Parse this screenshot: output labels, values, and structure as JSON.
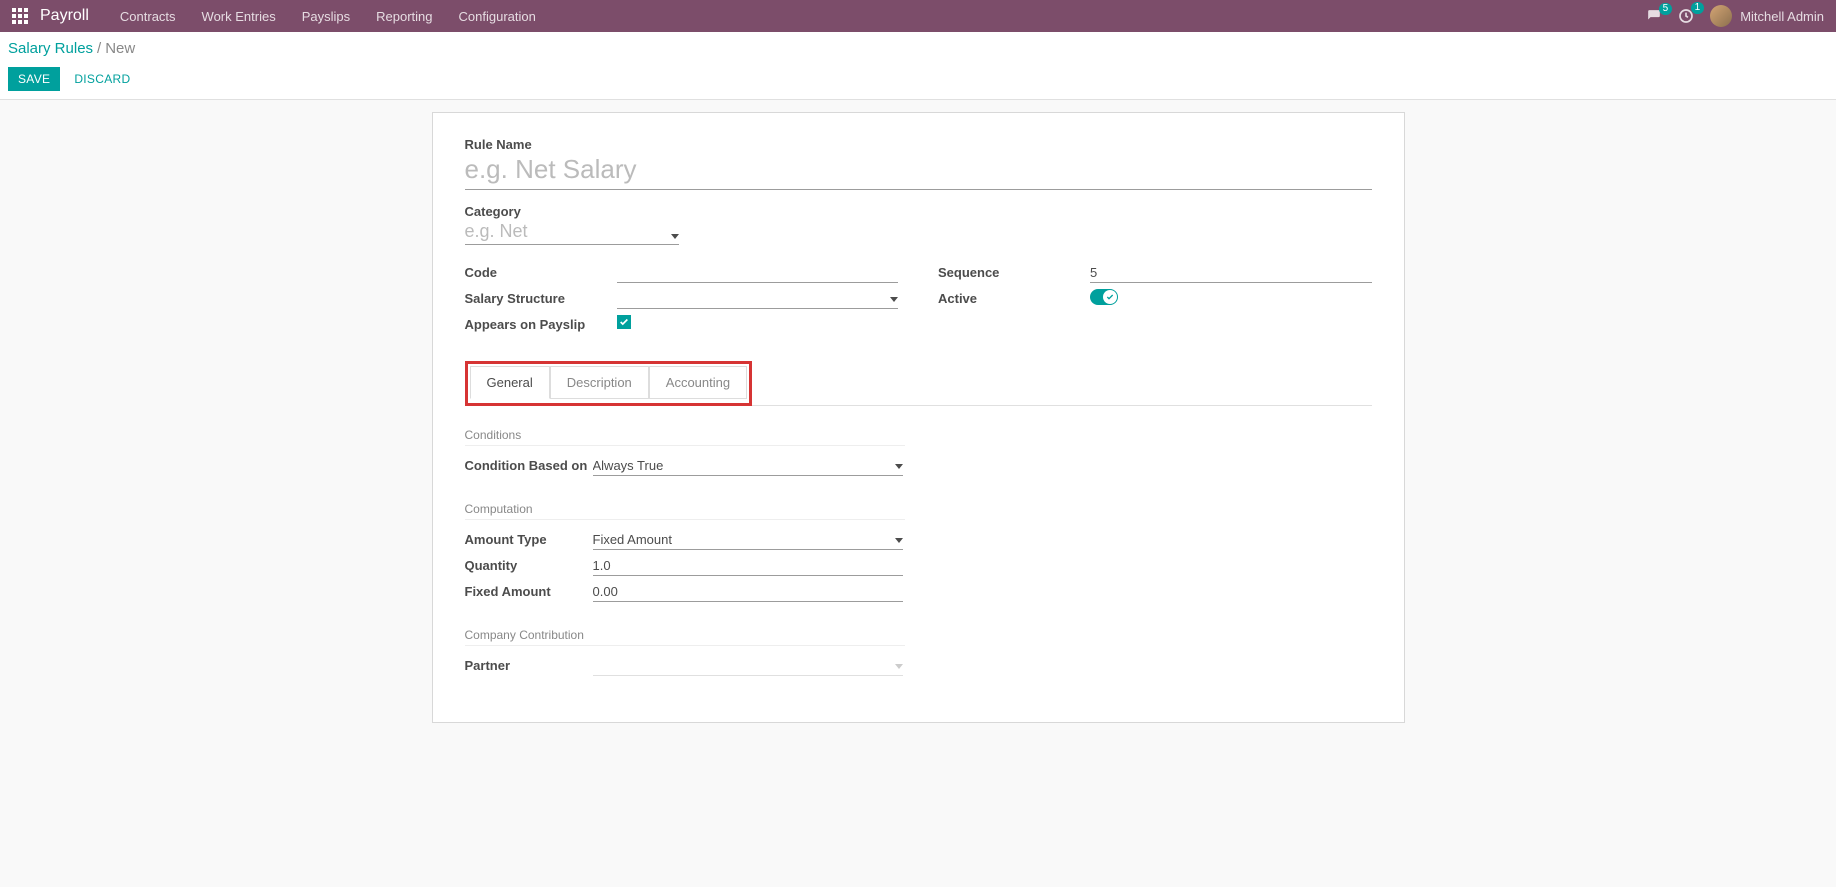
{
  "nav": {
    "brand": "Payroll",
    "items": [
      "Contracts",
      "Work Entries",
      "Payslips",
      "Reporting",
      "Configuration"
    ],
    "messages_badge": "5",
    "activities_badge": "1",
    "user_name": "Mitchell Admin"
  },
  "breadcrumb": {
    "parent": "Salary Rules",
    "current": "New"
  },
  "buttons": {
    "save": "SAVE",
    "discard": "DISCARD"
  },
  "form": {
    "rule_name_label": "Rule Name",
    "rule_name_placeholder": "e.g. Net Salary",
    "rule_name_value": "",
    "category_label": "Category",
    "category_placeholder": "e.g. Net",
    "category_value": "",
    "code_label": "Code",
    "code_value": "",
    "salary_structure_label": "Salary Structure",
    "salary_structure_value": "",
    "appears_label": "Appears on Payslip",
    "appears_value": true,
    "sequence_label": "Sequence",
    "sequence_value": "5",
    "active_label": "Active",
    "active_value": true
  },
  "tabs": [
    "General",
    "Description",
    "Accounting"
  ],
  "sections": {
    "conditions": {
      "title": "Conditions",
      "condition_based_label": "Condition Based on",
      "condition_based_value": "Always True"
    },
    "computation": {
      "title": "Computation",
      "amount_type_label": "Amount Type",
      "amount_type_value": "Fixed Amount",
      "quantity_label": "Quantity",
      "quantity_value": "1.0",
      "fixed_amount_label": "Fixed Amount",
      "fixed_amount_value": "0.00"
    },
    "company_contribution": {
      "title": "Company Contribution",
      "partner_label": "Partner",
      "partner_value": ""
    }
  }
}
